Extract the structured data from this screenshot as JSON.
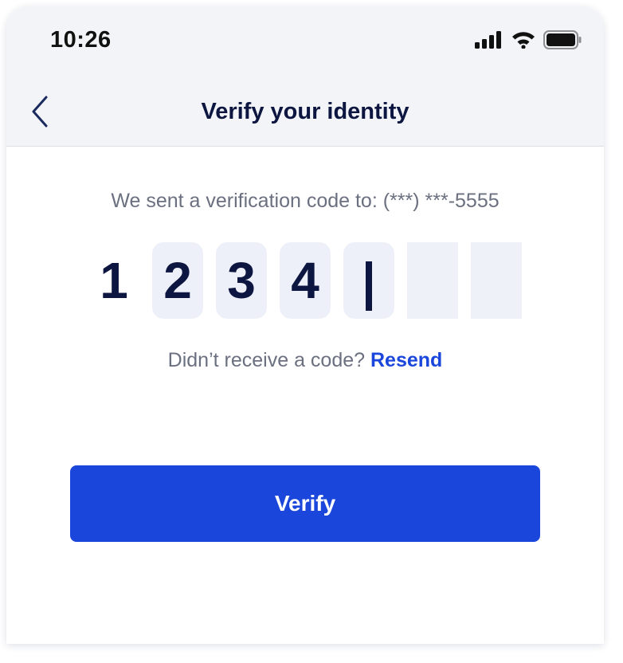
{
  "status_bar": {
    "time": "10:26",
    "icons": [
      "cellular-signal-icon",
      "wifi-icon",
      "battery-icon"
    ]
  },
  "nav": {
    "back_icon": "chevron-left-icon",
    "title": "Verify your identity"
  },
  "message": {
    "sent_prefix": "We sent a verification code to:",
    "phone_masked": "(***) ***-5555"
  },
  "code": {
    "digits": [
      "1",
      "2",
      "3",
      "4",
      "",
      "",
      ""
    ],
    "active_index": 4
  },
  "resend": {
    "prompt": "Didn’t receive a code?",
    "link_label": "Resend"
  },
  "actions": {
    "verify_label": "Verify"
  },
  "colors": {
    "primary": "#1a46dc",
    "heading": "#0c1640",
    "muted_text": "#6b7080",
    "header_bg": "#f3f4f8",
    "code_box_bg": "#eef0f9"
  }
}
